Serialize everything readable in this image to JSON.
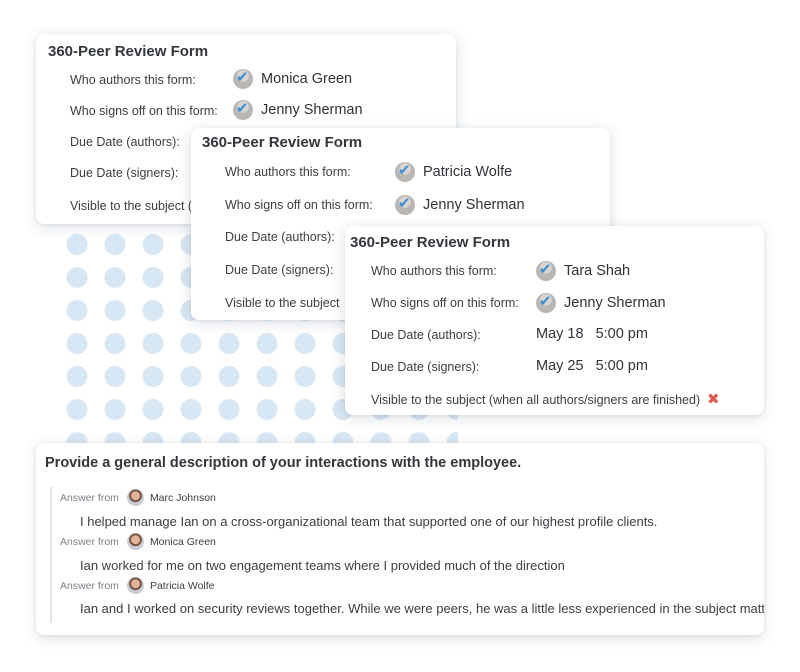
{
  "forms": [
    {
      "title": "360-Peer Review Form",
      "rows": [
        {
          "label": "Who authors this form:",
          "value": "Monica Green"
        },
        {
          "label": "Who signs off on this form:",
          "value": "Jenny Sherman"
        },
        {
          "label": "Due Date (authors):"
        },
        {
          "label": "Due Date (signers):"
        },
        {
          "label": "Visible to the subject (w"
        }
      ]
    },
    {
      "title": "360-Peer Review Form",
      "rows": [
        {
          "label": "Who authors this form:",
          "value": "Patricia Wolfe"
        },
        {
          "label": "Who signs off on this form:",
          "value": "Jenny Sherman"
        },
        {
          "label": "Due Date (authors):"
        },
        {
          "label": "Due Date (signers):"
        },
        {
          "label": "Visible to the subject"
        }
      ]
    },
    {
      "title": "360-Peer Review Form",
      "rows": [
        {
          "label": "Who authors this form:",
          "value": "Tara Shah"
        },
        {
          "label": "Who signs off on this form:",
          "value": "Jenny Sherman"
        },
        {
          "label": "Due Date (authors):",
          "date": "May 18",
          "time": "5:00 pm"
        },
        {
          "label": "Due Date (signers):",
          "date": "May 25",
          "time": "5:00 pm"
        },
        {
          "label": "Visible to the subject (when all authors/signers are finished)",
          "icon": "x-icon"
        }
      ]
    }
  ],
  "question": {
    "title": "Provide a general description of your interactions with the employee.",
    "answer_from_label": "Answer from",
    "answers": [
      {
        "author": "Marc Johnson",
        "text": "I helped manage Ian on a cross-organizational team that supported one of our highest profile clients."
      },
      {
        "author": "Monica Green",
        "text": "Ian worked for me on two engagement teams where I provided much of the direction"
      },
      {
        "author": "Patricia Wolfe",
        "text": "Ian and I worked on security reviews together. While we were peers, he was a little less experienced in the subject matter."
      }
    ]
  },
  "colors": {
    "accent": "#3d8fd6",
    "not_visible": "#e05a4f",
    "dots": "#d6e6f3"
  }
}
